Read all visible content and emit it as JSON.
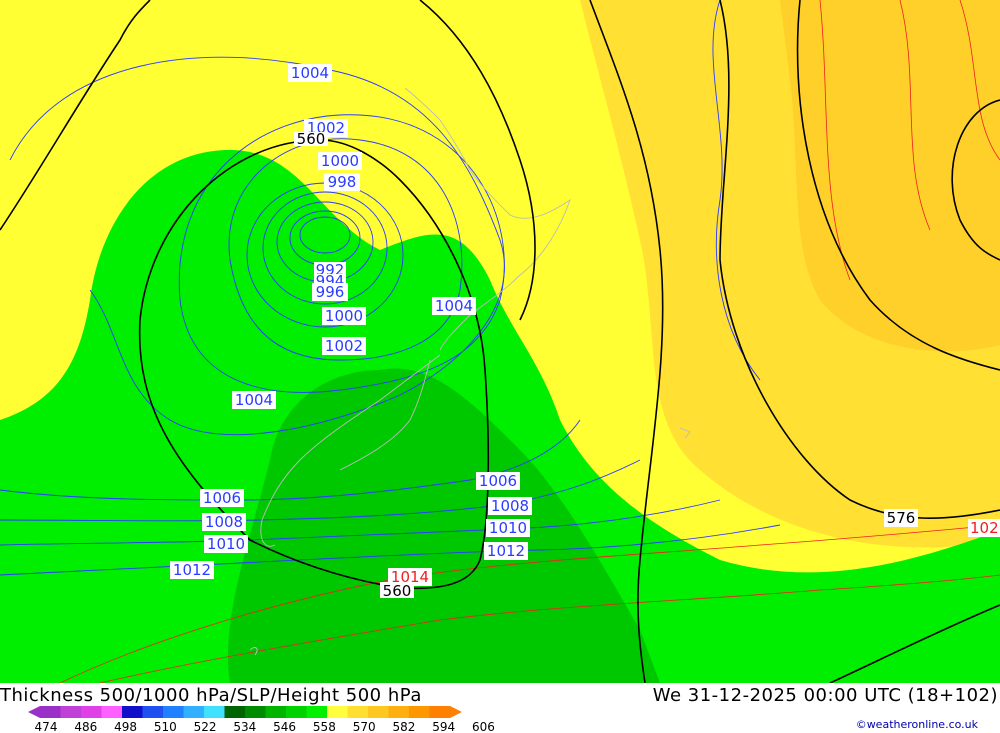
{
  "title": {
    "left": "Thickness 500/1000 hPa/SLP/Height 500 hPa",
    "right": "We 31-12-2025 00:00 UTC (18+102)"
  },
  "credit": "©weatheronline.co.uk",
  "legend": {
    "ticks": [
      "474",
      "486",
      "498",
      "510",
      "522",
      "534",
      "546",
      "558",
      "570",
      "582",
      "594",
      "606"
    ],
    "colors": [
      "#9b30c8",
      "#c040d8",
      "#e040e8",
      "#ff60ff",
      "#1010c8",
      "#2050f0",
      "#2080ff",
      "#30b0ff",
      "#40e0ff",
      "#006400",
      "#008c00",
      "#00b400",
      "#00d200",
      "#00f000",
      "#ffff40",
      "#ffe030",
      "#ffc820",
      "#ffb010",
      "#ff9800",
      "#ff8000"
    ]
  },
  "isobar_labels": {
    "blue": [
      "1004",
      "1002",
      "1000",
      "998",
      "992",
      "994",
      "996",
      "1000",
      "1002",
      "1004",
      "1004",
      "1006",
      "1008",
      "1010",
      "1012",
      "1006",
      "1008",
      "1010",
      "1012"
    ],
    "red": [
      "1014",
      "102"
    ]
  },
  "height_labels": [
    "560",
    "560",
    "576"
  ],
  "colors": {
    "yellow": "#ffff33",
    "yellow_orange": "#ffe033",
    "orange": "#ffd02a",
    "green": "#00ee00",
    "green_dark": "#00c800",
    "isobar_blue": "#2a3cff",
    "isobar_red": "#ee2020"
  }
}
